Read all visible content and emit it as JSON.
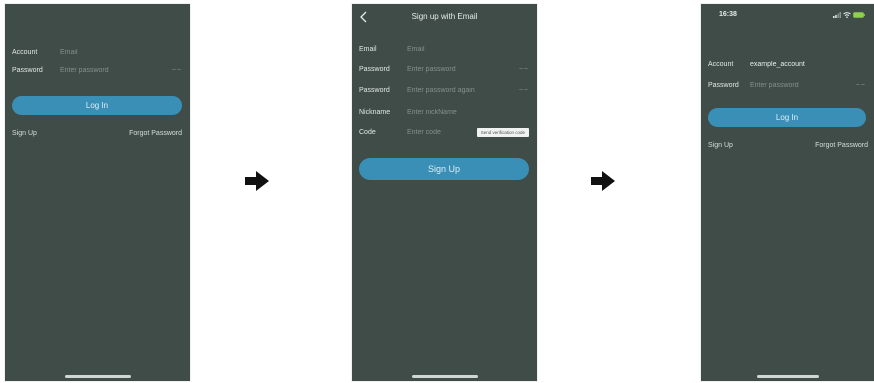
{
  "screen_1": {
    "account_label": "Account",
    "account_placeholder": "Email",
    "password_label": "Password",
    "password_placeholder": "Enter password",
    "eye_glyph": "~~",
    "login_button": "Log In",
    "sign_up_link": "Sign Up",
    "forgot_link": "Forgot Password"
  },
  "screen_2": {
    "title": "Sign up with Email",
    "back_icon": "chevron-left-icon",
    "email_label": "Email",
    "email_placeholder": "Email",
    "password_label": "Password",
    "password_placeholder": "Enter password",
    "confirm_label": "Password",
    "confirm_placeholder": "Enter password again",
    "nickname_label": "Nickname",
    "nickname_placeholder": "Enter nickName",
    "code_label": "Code",
    "code_placeholder": "Enter code",
    "code_button": "Send verification code",
    "eye_glyph": "~~",
    "sign_up_button": "Sign Up"
  },
  "screen_3": {
    "status_time": "16:38",
    "status_icons": [
      "signal-icon",
      "wifi-icon",
      "battery-icon"
    ],
    "account_label": "Account",
    "account_value": "example_account",
    "password_label": "Password",
    "password_placeholder": "Enter password",
    "eye_glyph": "~~",
    "login_button": "Log In",
    "sign_up_link": "Sign Up",
    "forgot_link": "Forgot Password"
  },
  "flow": {
    "arrow_icon": "arrow-right-icon"
  },
  "colors": {
    "screen_bg": "#3f4c48",
    "primary_button": "#3a8fb6",
    "arrow": "#111111",
    "battery": "#8fd14f"
  }
}
